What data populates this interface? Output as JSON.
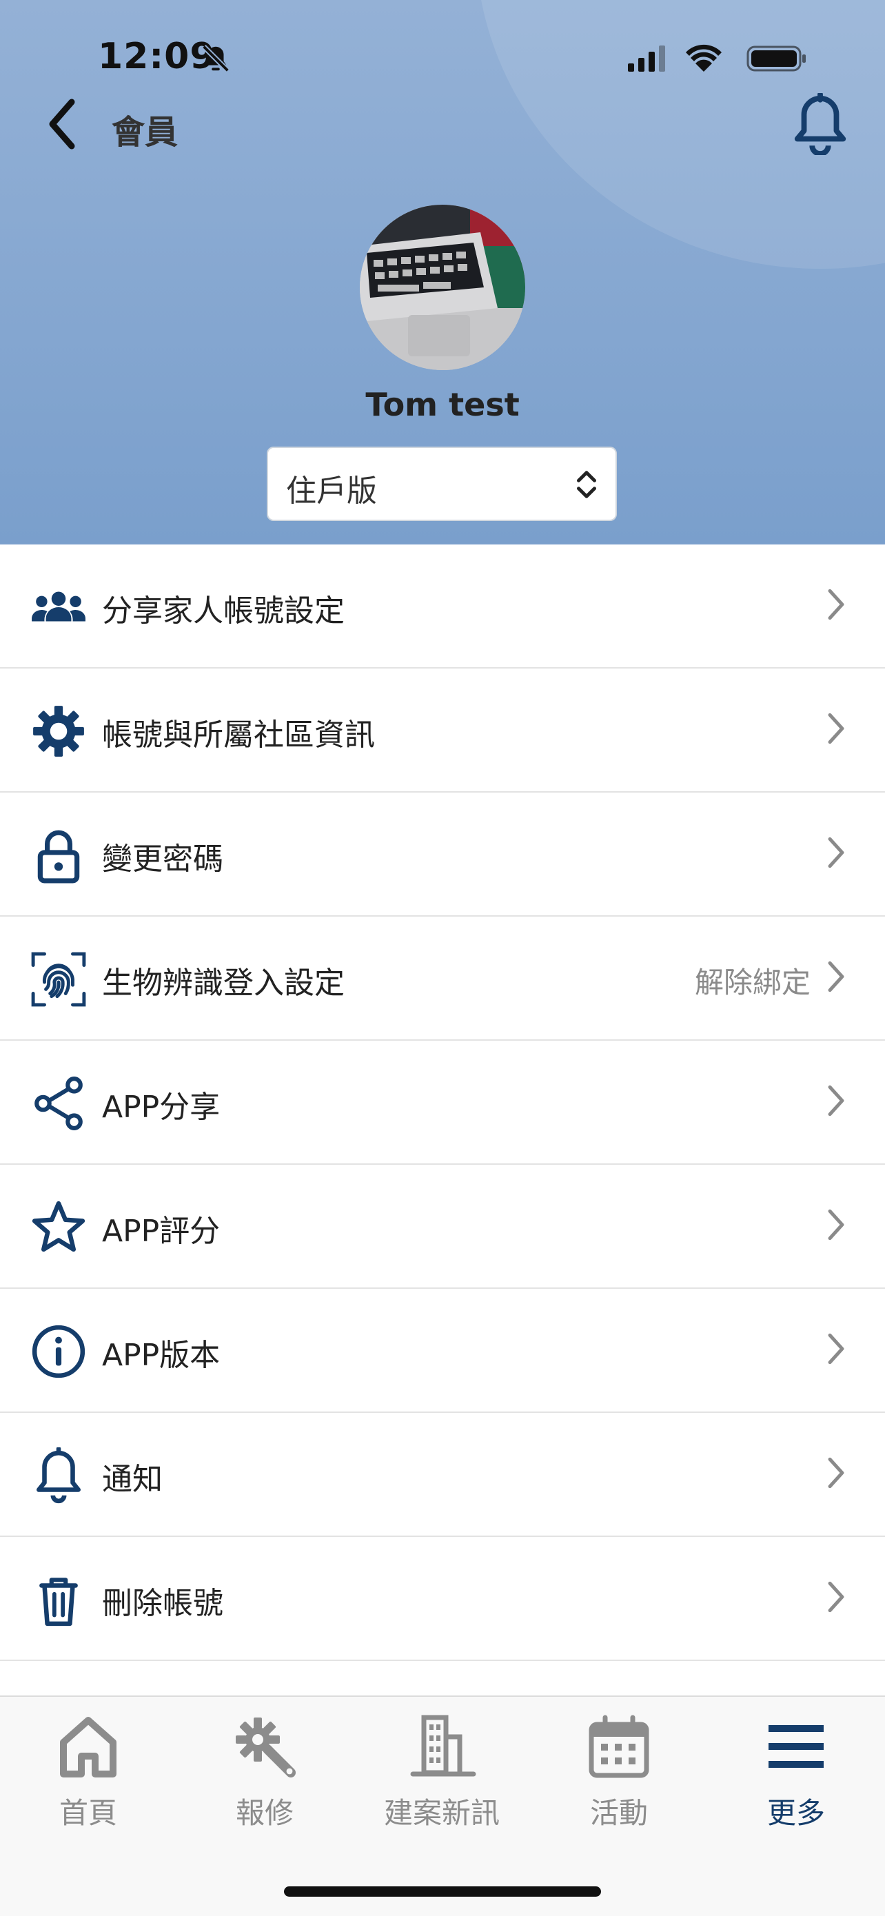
{
  "status_bar": {
    "time": "12:09"
  },
  "nav": {
    "title": "會員"
  },
  "profile": {
    "name": "Tom test",
    "version_selector": "住戶版"
  },
  "menu": [
    {
      "label": "分享家人帳號設定",
      "extra": ""
    },
    {
      "label": "帳號與所屬社區資訊",
      "extra": ""
    },
    {
      "label": "變更密碼",
      "extra": ""
    },
    {
      "label": "生物辨識登入設定",
      "extra": "解除綁定"
    },
    {
      "label": "APP分享",
      "extra": ""
    },
    {
      "label": "APP評分",
      "extra": ""
    },
    {
      "label": "APP版本",
      "extra": ""
    },
    {
      "label": "通知",
      "extra": ""
    },
    {
      "label": "刪除帳號",
      "extra": ""
    }
  ],
  "tabbar": [
    {
      "label": "首頁",
      "icon": "home-icon"
    },
    {
      "label": "報修",
      "icon": "repair-icon"
    },
    {
      "label": "建案新訊",
      "icon": "building-icon"
    },
    {
      "label": "活動",
      "icon": "calendar-icon"
    },
    {
      "label": "更多",
      "icon": "menu-icon"
    }
  ],
  "colors": {
    "accent": "#153d6b",
    "header_top": "#94b1d6",
    "header_bottom": "#7a9fcc",
    "inactive": "#8c8c8c"
  }
}
